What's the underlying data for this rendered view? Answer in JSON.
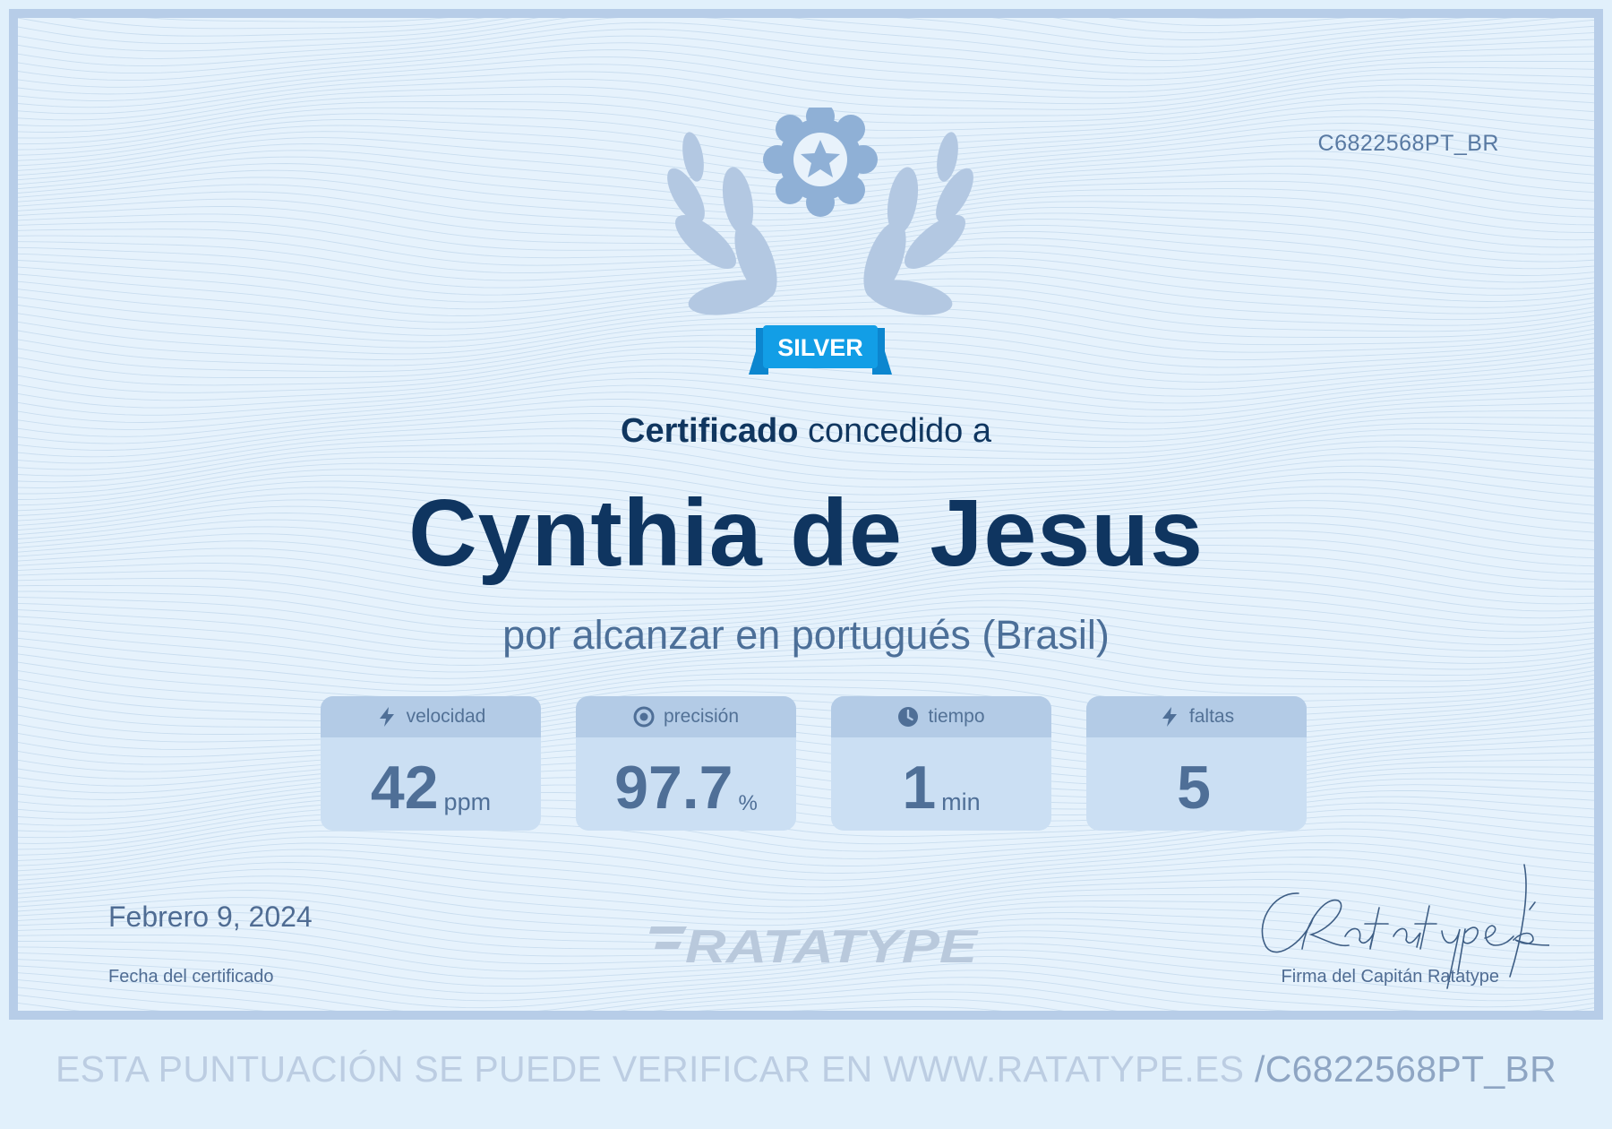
{
  "certificate": {
    "id": "C6822568PT_BR",
    "badge": "SILVER",
    "heading_bold": "Certificado",
    "heading_rest": "concedido a",
    "recipient_name": "Cynthia de Jesus",
    "subtitle": "por alcanzar en portugués (Brasil)"
  },
  "stats": [
    {
      "icon": "lightning-icon",
      "label": "velocidad",
      "value": "42",
      "unit": "ppm"
    },
    {
      "icon": "target-icon",
      "label": "precisión",
      "value": "97.7",
      "unit": "%"
    },
    {
      "icon": "clock-icon",
      "label": "tiempo",
      "value": "1",
      "unit": "min"
    },
    {
      "icon": "lightning-icon",
      "label": "faltas",
      "value": "5",
      "unit": ""
    }
  ],
  "footer_info": {
    "date": "Febrero 9, 2024",
    "date_label": "Fecha del certificado",
    "logo_text": "RATATYPE",
    "signature_text": "CRatatype fé",
    "signature_label": "Firma del Capitán Ratatype"
  },
  "verify": {
    "text": "ESTA PUNTUACIÓN SE PUEDE VERIFICAR EN WWW.RATATYPE.ES",
    "code": "/C6822568PT_BR"
  },
  "colors": {
    "page_bg": "#e1f0fb",
    "border": "#b7cde8",
    "navy": "#0f3560",
    "muted_blue": "#4c6f98",
    "badge_blue": "#129ee6",
    "stat_card": "#cbdff3"
  }
}
